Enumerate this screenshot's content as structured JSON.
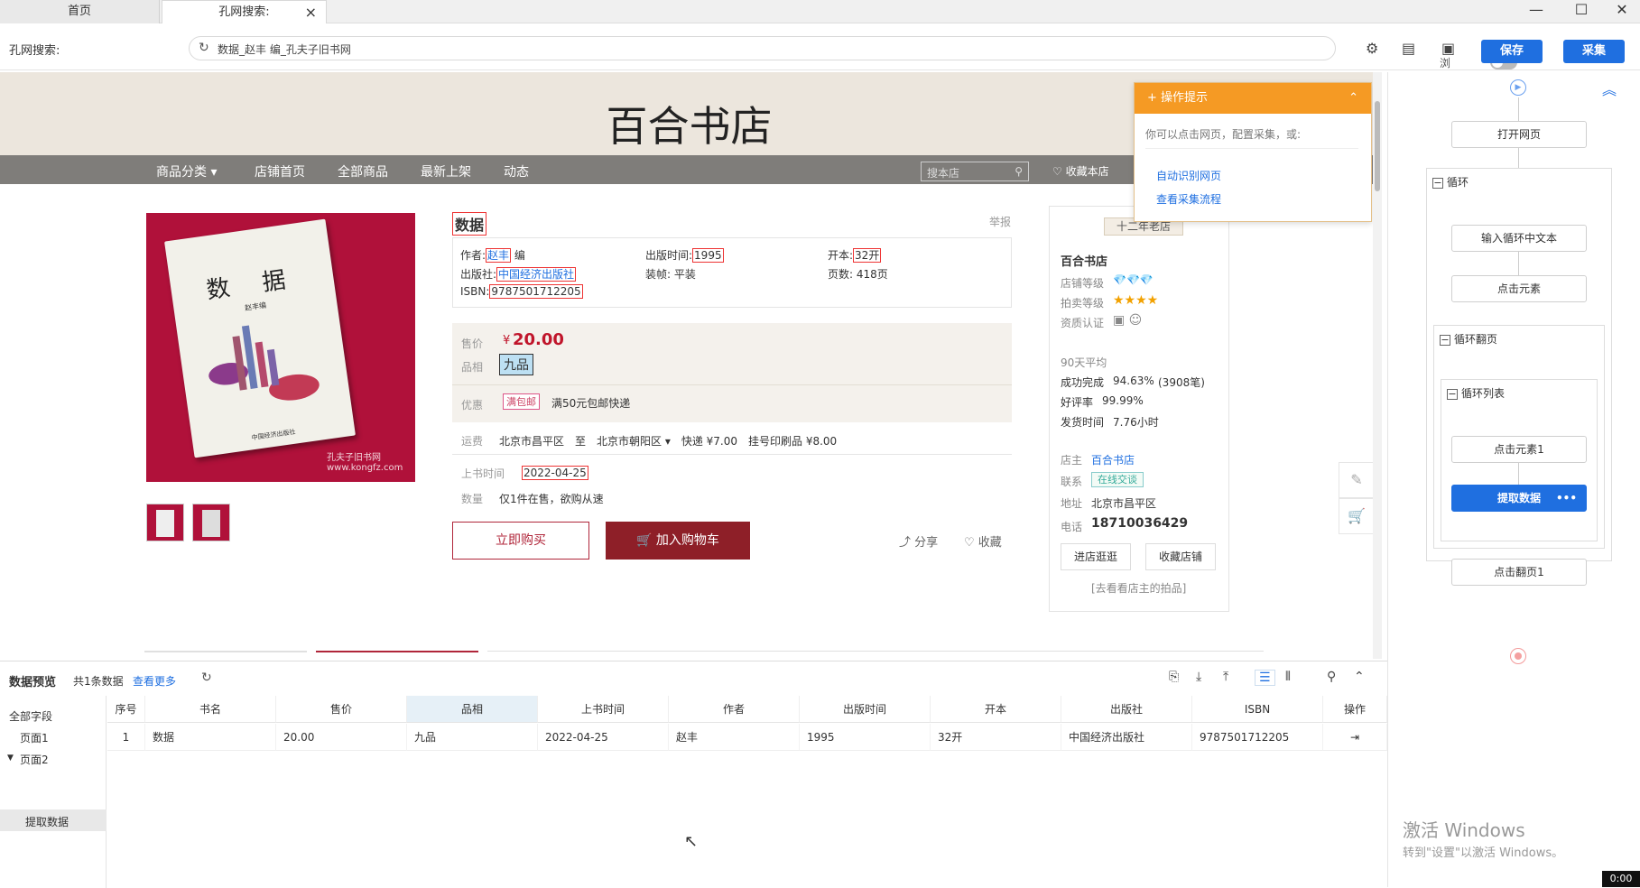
{
  "tabs": [
    {
      "label": "首页"
    },
    {
      "label": "孔网搜索:"
    }
  ],
  "window": {
    "minimize": "—",
    "maximize": "☐",
    "close": "✕"
  },
  "address": {
    "label": "孔网搜索:",
    "url": "数据_赵丰 编_孔夫子旧书网",
    "browse_mode": "浏览模式"
  },
  "toolbar": {
    "save": "保存",
    "collect": "采集"
  },
  "store": {
    "title": "百合书店",
    "nav": [
      "商品分类 ▾",
      "店铺首页",
      "全部商品",
      "最新上架",
      "动态"
    ],
    "search_placeholder": "搜本店",
    "fav_store": "♡ 收藏本店"
  },
  "book": {
    "cover_title": "数 据",
    "cover_author": "赵丰编",
    "cover_publisher": "中国经济出版社",
    "watermark": "孔夫子旧书网 www.kongfz.com",
    "name": "数据",
    "report": "举报",
    "author_label": "作者:",
    "author": "赵丰",
    "author_suffix": "编",
    "pubdate_label": "出版时间:",
    "pubdate": "1995",
    "format_label": "开本:",
    "format": "32开",
    "publisher_label": "出版社:",
    "publisher": "中国经济出版社",
    "binding": "装帧: 平装",
    "pages": "页数: 418页",
    "isbn_label": "ISBN:",
    "isbn": "9787501712205",
    "price_label": "售价",
    "price_symbol": "¥",
    "price": "20.00",
    "cond_label": "品相",
    "condition": "九品",
    "promo_label": "优惠",
    "promo_tag": "满包邮",
    "promo_text": "满50元包邮快递",
    "ship_label": "运费",
    "ship_text": "北京市昌平区　至　北京市朝阳区 ▾　快递 ¥7.00　挂号印刷品 ¥8.00",
    "listed_label": "上书时间",
    "listed": "2022-04-25",
    "qty_label": "数量",
    "qty": "仅1件在售，欲购从速",
    "buy": "立即购买",
    "cart": "🛒 加入购物车",
    "share": "分享",
    "collect": "收藏"
  },
  "shop": {
    "badge": "十二年老店",
    "name": "百合书店",
    "level_label": "店铺等级",
    "level": "💎💎💎",
    "auction_label": "拍卖等级",
    "auction": "★★★★",
    "cert_label": "资质认证",
    "cert": "▣ ☺",
    "avg": "90天平均",
    "success_label": "成功完成",
    "success": "94.63%",
    "success_count": "(3908笔)",
    "good_label": "好评率",
    "good": "99.99%",
    "ship_label": "发货时间",
    "ship": "7.76小时",
    "owner_label": "店主",
    "owner": "百合书店",
    "contact_label": "联系",
    "contact": "在线交谈",
    "addr_label": "地址",
    "addr": "北京市昌平区",
    "phone_label": "电话",
    "phone": "18710036429",
    "enter": "进店逛逛",
    "fav": "收藏店铺",
    "auction_link": "[去看看店主的拍品]"
  },
  "tip": {
    "title": "操作提示",
    "body": "你可以点击网页，配置采集，或:",
    "link1": "自动识别网页",
    "link2": "查看采集流程"
  },
  "flow": {
    "open": "打开网页",
    "loop": "循环",
    "input": "输入循环中文本",
    "click": "点击元素",
    "page_loop": "循环翻页",
    "list_loop": "循环列表",
    "click1": "点击元素1",
    "extract": "提取数据",
    "next": "点击翻页1"
  },
  "preview": {
    "title": "数据预览",
    "count": "共1条数据",
    "more": "查看更多",
    "tree": [
      "全部字段",
      "页面1",
      "页面2",
      "提取数据"
    ],
    "columns": [
      "序号",
      "书名",
      "售价",
      "品相",
      "上书时间",
      "作者",
      "出版时间",
      "开本",
      "出版社",
      "ISBN",
      "操作"
    ],
    "row": [
      "1",
      "数据",
      "20.00",
      "九品",
      "2022-04-25",
      "赵丰",
      "1995",
      "32开",
      "中国经济出版社",
      "9787501712205",
      "⇥"
    ]
  },
  "activate": {
    "title": "激活 Windows",
    "sub": "转到\"设置\"以激活 Windows。"
  },
  "timer": "0:00"
}
